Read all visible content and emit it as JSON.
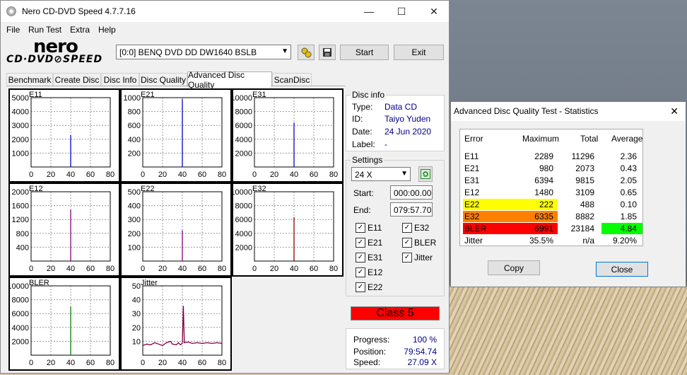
{
  "window": {
    "title": "Nero CD-DVD Speed 4.7.7.16",
    "minimize": "—",
    "maximize": "☐",
    "close": "✕"
  },
  "menu": [
    "File",
    "Run Test",
    "Extra",
    "Help"
  ],
  "logo": {
    "brand": "nero",
    "product": "CD·DVD⊘SPEED"
  },
  "toolbar": {
    "drive": "[0:0]   BENQ DVD DD DW1640 BSLB",
    "start_label": "Start",
    "exit_label": "Exit",
    "icons": [
      "properties-icon",
      "save-icon"
    ]
  },
  "tabs": [
    "Benchmark",
    "Create Disc",
    "Disc Info",
    "Disc Quality",
    "Advanced Disc Quality",
    "ScanDisc"
  ],
  "active_tab": "Advanced Disc Quality",
  "disc_info": {
    "title": "Disc info",
    "type_label": "Type:",
    "type": "Data CD",
    "id_label": "ID:",
    "id": "Taiyo Yuden",
    "date_label": "Date:",
    "date": "24 Jun 2020",
    "label_label": "Label:",
    "label": "-"
  },
  "settings": {
    "title": "Settings",
    "speed": "24 X",
    "start_label": "Start:",
    "start": "000:00.00",
    "end_label": "End:",
    "end": "079:57.70",
    "checks": [
      {
        "label": "E11",
        "checked": true
      },
      {
        "label": "E32",
        "checked": true
      },
      {
        "label": "E21",
        "checked": true
      },
      {
        "label": "BLER",
        "checked": true
      },
      {
        "label": "E31",
        "checked": true
      },
      {
        "label": "Jitter",
        "checked": true
      },
      {
        "label": "E12",
        "checked": true
      },
      {
        "label": "E22",
        "checked": true
      }
    ]
  },
  "class_result": "Class 5",
  "progress": {
    "progress_label": "Progress:",
    "progress": "100 %",
    "position_label": "Position:",
    "position": "79:54.74",
    "speed_label": "Speed:",
    "speed": "27.09 X"
  },
  "stats_dialog": {
    "title": "Advanced Disc Quality Test - Statistics",
    "close_glyph": "✕",
    "headers": [
      "Error",
      "Maximum",
      "Total",
      "Average"
    ],
    "rows": [
      {
        "error": "E11",
        "maximum": "2289",
        "total": "11296",
        "average": "2.36"
      },
      {
        "error": "E21",
        "maximum": "980",
        "total": "2073",
        "average": "0.43"
      },
      {
        "error": "E31",
        "maximum": "6394",
        "total": "9815",
        "average": "2.05"
      },
      {
        "error": "E12",
        "maximum": "1480",
        "total": "3109",
        "average": "0.65"
      },
      {
        "error": "E22",
        "maximum": "222",
        "total": "488",
        "average": "0.10"
      },
      {
        "error": "E32",
        "maximum": "6335",
        "total": "8882",
        "average": "1.85"
      },
      {
        "error": "BLER",
        "maximum": "6991",
        "total": "23184",
        "average": "4.84"
      },
      {
        "error": "Jitter",
        "maximum": "35.5%",
        "total": "n/a",
        "average": "9.20%"
      }
    ],
    "highlight_colors": {
      "E22": "#ffff00",
      "E32": "#ff8000",
      "BLER": "#ff0000",
      "BLER_avg": "#00ff00"
    },
    "copy_label": "Copy",
    "close_label": "Close"
  },
  "chart_data": [
    {
      "type": "line",
      "title": "E11",
      "x_ticks": [
        0,
        20,
        40,
        60,
        80
      ],
      "y_ticks": [
        1000,
        2000,
        3000,
        4000,
        5000
      ],
      "ylim": [
        0,
        5000
      ],
      "xlim": [
        0,
        80
      ],
      "color": "#0000cc",
      "spikes": [
        [
          40,
          2289
        ]
      ],
      "baseline": 0
    },
    {
      "type": "line",
      "title": "E21",
      "x_ticks": [
        0,
        20,
        40,
        60,
        80
      ],
      "y_ticks": [
        200,
        400,
        600,
        800,
        1000
      ],
      "ylim": [
        0,
        1000
      ],
      "xlim": [
        0,
        80
      ],
      "color": "#0000cc",
      "spikes": [
        [
          40,
          980
        ]
      ],
      "baseline": 0
    },
    {
      "type": "line",
      "title": "E31",
      "x_ticks": [
        0,
        20,
        40,
        60,
        80
      ],
      "y_ticks": [
        2000,
        4000,
        6000,
        8000,
        10000
      ],
      "ylim": [
        0,
        10000
      ],
      "xlim": [
        0,
        80
      ],
      "color": "#0000cc",
      "spikes": [
        [
          40,
          6394
        ]
      ],
      "baseline": 0
    },
    {
      "type": "line",
      "title": "E12",
      "x_ticks": [
        0,
        20,
        40,
        60,
        80
      ],
      "y_ticks": [
        400,
        800,
        1200,
        1600,
        2000
      ],
      "ylim": [
        0,
        2000
      ],
      "xlim": [
        0,
        80
      ],
      "color": "#800080",
      "spikes": [
        [
          40,
          1480
        ]
      ],
      "baseline": 0
    },
    {
      "type": "line",
      "title": "E22",
      "x_ticks": [
        0,
        20,
        40,
        60,
        80
      ],
      "y_ticks": [
        100,
        200,
        300,
        400,
        500
      ],
      "ylim": [
        0,
        500
      ],
      "xlim": [
        0,
        80
      ],
      "color": "#800080",
      "spikes": [
        [
          40,
          222
        ]
      ],
      "baseline": 0
    },
    {
      "type": "line",
      "title": "E32",
      "x_ticks": [
        0,
        20,
        40,
        60,
        80
      ],
      "y_ticks": [
        2000,
        4000,
        6000,
        8000,
        10000
      ],
      "ylim": [
        0,
        10000
      ],
      "xlim": [
        0,
        80
      ],
      "color": "#8b0000",
      "spikes": [
        [
          40,
          6335
        ]
      ],
      "baseline": 0
    },
    {
      "type": "line",
      "title": "BLER",
      "x_ticks": [
        0,
        20,
        40,
        60,
        80
      ],
      "y_ticks": [
        2000,
        4000,
        6000,
        8000,
        10000
      ],
      "ylim": [
        0,
        10000
      ],
      "xlim": [
        0,
        80
      ],
      "color": "#008000",
      "spikes": [
        [
          40,
          6991
        ]
      ],
      "baseline": 0
    },
    {
      "type": "line",
      "title": "Jitter",
      "x_ticks": [
        0,
        20,
        40,
        60,
        80
      ],
      "y_ticks": [
        10,
        20,
        30,
        40,
        50
      ],
      "ylim": [
        0,
        50
      ],
      "xlim": [
        0,
        80
      ],
      "color": "#800040",
      "series": [
        {
          "x": [
            0,
            4,
            8,
            12,
            16,
            20,
            24,
            28,
            30,
            34,
            36,
            38,
            40,
            41,
            42,
            46,
            50,
            55,
            60,
            65,
            70,
            75,
            80
          ],
          "y": [
            7,
            8,
            7.5,
            9,
            8,
            7,
            9,
            10,
            8,
            7.5,
            9,
            7.5,
            8.5,
            35.5,
            9,
            9.5,
            8.5,
            9,
            8.5,
            9,
            8.5,
            9,
            8.5
          ]
        }
      ]
    }
  ]
}
